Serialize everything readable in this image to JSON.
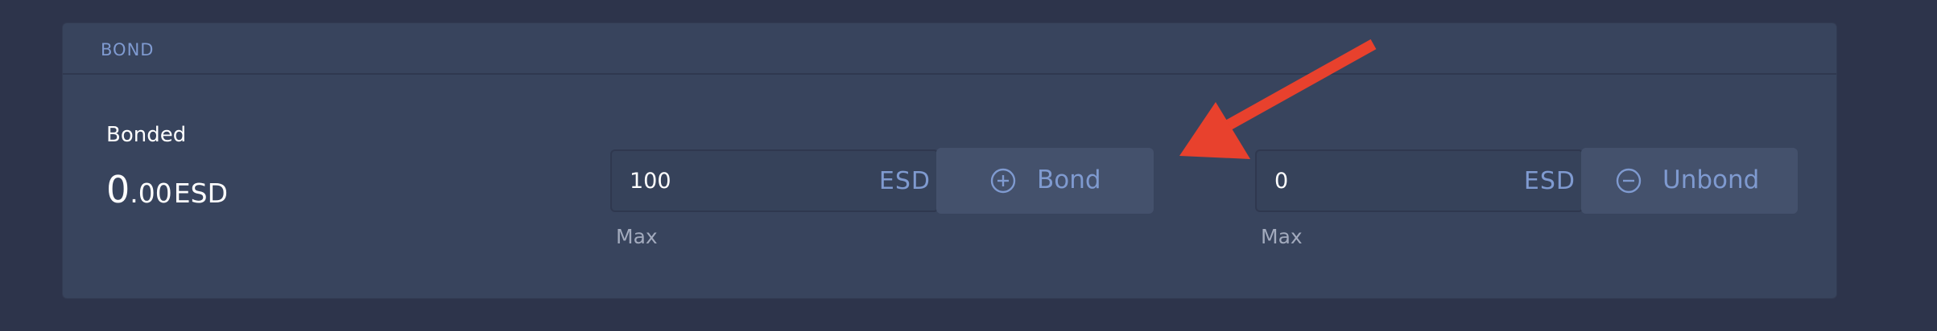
{
  "panel": {
    "title": "BOND"
  },
  "bonded": {
    "label": "Bonded",
    "integer": "0",
    "decimals": ".00",
    "unit": "ESD"
  },
  "bond": {
    "input_value": "100",
    "unit": "ESD",
    "button_label": "Bond",
    "max_label": "Max",
    "icon": "plus-circle-icon"
  },
  "unbond": {
    "input_value": "0",
    "unit": "ESD",
    "button_label": "Unbond",
    "max_label": "Max",
    "icon": "minus-circle-icon"
  },
  "annotation": {
    "icon": "red-arrow-annotation",
    "color": "#e8412d"
  },
  "colors": {
    "background": "#2d344b",
    "panel": "#38445d",
    "accent": "#7f9ad0",
    "button": "#44516c"
  }
}
